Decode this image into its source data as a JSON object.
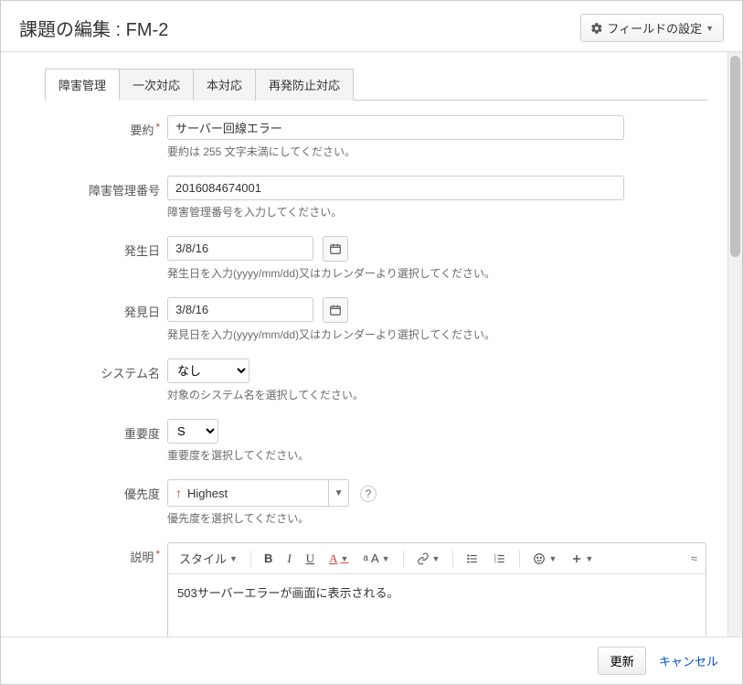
{
  "header": {
    "title": "課題の編集 : FM-2",
    "config_label": "フィールドの設定"
  },
  "tabs": [
    {
      "label": "障害管理",
      "active": true
    },
    {
      "label": "一次対応",
      "active": false
    },
    {
      "label": "本対応",
      "active": false
    },
    {
      "label": "再発防止対応",
      "active": false
    }
  ],
  "fields": {
    "summary": {
      "label": "要約",
      "value": "サーバー回線エラー",
      "hint": "要約は 255 文字未満にしてください。"
    },
    "incident_no": {
      "label": "障害管理番号",
      "value": "2016084674001",
      "hint": "障害管理番号を入力してください。"
    },
    "occur_date": {
      "label": "発生日",
      "value": "3/8/16",
      "hint": "発生日を入力(yyyy/mm/dd)又はカレンダーより選択してください。"
    },
    "found_date": {
      "label": "発見日",
      "value": "3/8/16",
      "hint": "発見日を入力(yyyy/mm/dd)又はカレンダーより選択してください。"
    },
    "system": {
      "label": "システム名",
      "value": "なし",
      "hint": "対象のシステム名を選択してください。"
    },
    "severity": {
      "label": "重要度",
      "value": "S",
      "hint": "重要度を選択してください。"
    },
    "priority": {
      "label": "優先度",
      "value": "Highest",
      "hint": "優先度を選択してください。"
    },
    "description": {
      "label": "説明",
      "value": "503サーバーエラーが画面に表示される。"
    }
  },
  "editor_toolbar": {
    "style_label": "スタイル"
  },
  "footer": {
    "submit": "更新",
    "cancel": "キャンセル"
  }
}
